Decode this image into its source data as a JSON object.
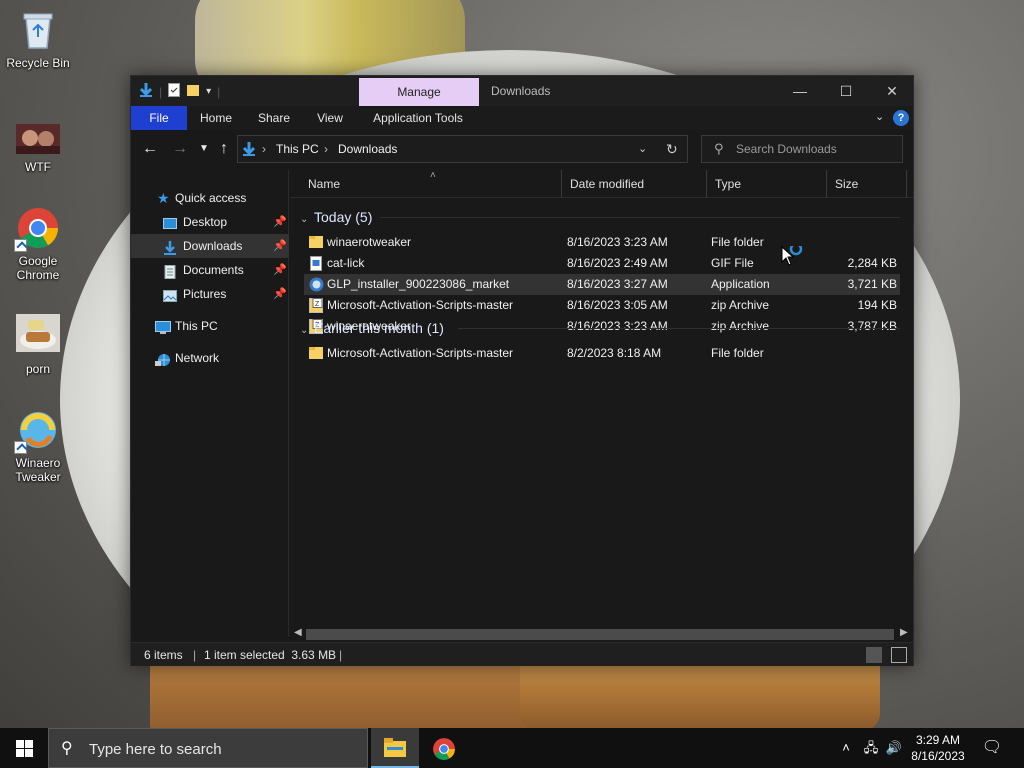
{
  "desktop": {
    "icons": [
      {
        "label": "Recycle Bin"
      },
      {
        "label": "WTF"
      },
      {
        "label": "Google Chrome"
      },
      {
        "label": "porn"
      },
      {
        "label": "Winaero Tweaker"
      }
    ]
  },
  "window": {
    "title": "Downloads",
    "contextual_tab": "Manage",
    "ribbon_tabs": [
      "File",
      "Home",
      "Share",
      "View",
      "Application Tools"
    ],
    "breadcrumb": [
      "This PC",
      "Downloads"
    ],
    "search_placeholder": "Search Downloads"
  },
  "navpane": {
    "items": [
      {
        "label": "Quick access"
      },
      {
        "label": "Desktop"
      },
      {
        "label": "Downloads"
      },
      {
        "label": "Documents"
      },
      {
        "label": "Pictures"
      },
      {
        "label": "This PC"
      },
      {
        "label": "Network"
      }
    ]
  },
  "columns": [
    "Name",
    "Date modified",
    "Type",
    "Size"
  ],
  "groups": [
    {
      "label": "Today (5)",
      "files": [
        {
          "name": "winaerotweaker",
          "date": "8/16/2023 3:23 AM",
          "type": "File folder",
          "size": "",
          "icon": "folder-icon"
        },
        {
          "name": "cat-lick",
          "date": "8/16/2023 2:49 AM",
          "type": "GIF File",
          "size": "2,284 KB",
          "icon": "gif-file-icon"
        },
        {
          "name": "GLP_installer_900223086_market",
          "date": "8/16/2023 3:27 AM",
          "type": "Application",
          "size": "3,721 KB",
          "icon": "application-icon"
        },
        {
          "name": "Microsoft-Activation-Scripts-master",
          "date": "8/16/2023 3:05 AM",
          "type": "zip Archive",
          "size": "194 KB",
          "icon": "zip-archive-icon"
        },
        {
          "name": "winaerotweaker",
          "date": "8/16/2023 3:23 AM",
          "type": "zip Archive",
          "size": "3,787 KB",
          "icon": "zip-archive-icon"
        }
      ]
    },
    {
      "label": "Earlier this month (1)",
      "files": [
        {
          "name": "Microsoft-Activation-Scripts-master",
          "date": "8/2/2023 8:18 AM",
          "type": "File folder",
          "size": "",
          "icon": "folder-icon"
        }
      ]
    }
  ],
  "status": {
    "items_count": "6 items",
    "selection": "1 item selected  3.63 MB"
  },
  "taskbar": {
    "search_placeholder": "Type here to search",
    "time": "3:29 AM",
    "date": "8/16/2023"
  },
  "colors": {
    "accent": "#1f3fd0",
    "manage_tab": "#e6cdf5",
    "selection": "#333333"
  }
}
